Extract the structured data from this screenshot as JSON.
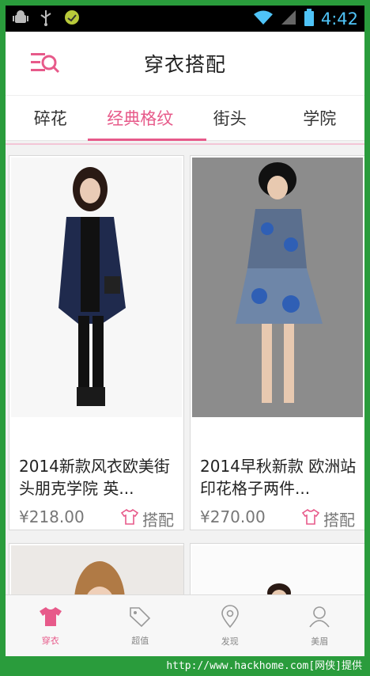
{
  "status_bar": {
    "time": "4:42",
    "left_icons": [
      "android-debug-icon",
      "usb-icon",
      "battery-saver-icon"
    ],
    "right_icons": [
      "wifi-icon",
      "signal-icon",
      "battery-icon"
    ]
  },
  "header": {
    "title": "穿衣搭配",
    "menu_icon": "search-menu-icon"
  },
  "tabs": [
    {
      "label": "碎花",
      "active": false
    },
    {
      "label": "经典格纹",
      "active": true
    },
    {
      "label": "街头",
      "active": false
    },
    {
      "label": "学院",
      "active": false
    }
  ],
  "products": [
    {
      "caption": "2014新款风衣欧美街头朋克学院 英...",
      "price": "¥218.00",
      "action": "搭配"
    },
    {
      "caption": "2014早秋新款 欧洲站印花格子两件...",
      "price": "¥270.00",
      "action": "搭配"
    }
  ],
  "bottom_nav": [
    {
      "label": "穿衣",
      "icon": "tshirt-icon",
      "active": true
    },
    {
      "label": "超值",
      "icon": "tag-icon",
      "active": false
    },
    {
      "label": "发现",
      "icon": "location-pin-icon",
      "active": false
    },
    {
      "label": "美眉",
      "icon": "girl-icon",
      "active": false
    }
  ],
  "watermark": "http://www.hackhome.com[网侠]提供",
  "colors": {
    "accent": "#e75a8a",
    "status_bar": "#000000",
    "clock": "#4fc3f7",
    "watermark_band": "#2a9c3c"
  }
}
